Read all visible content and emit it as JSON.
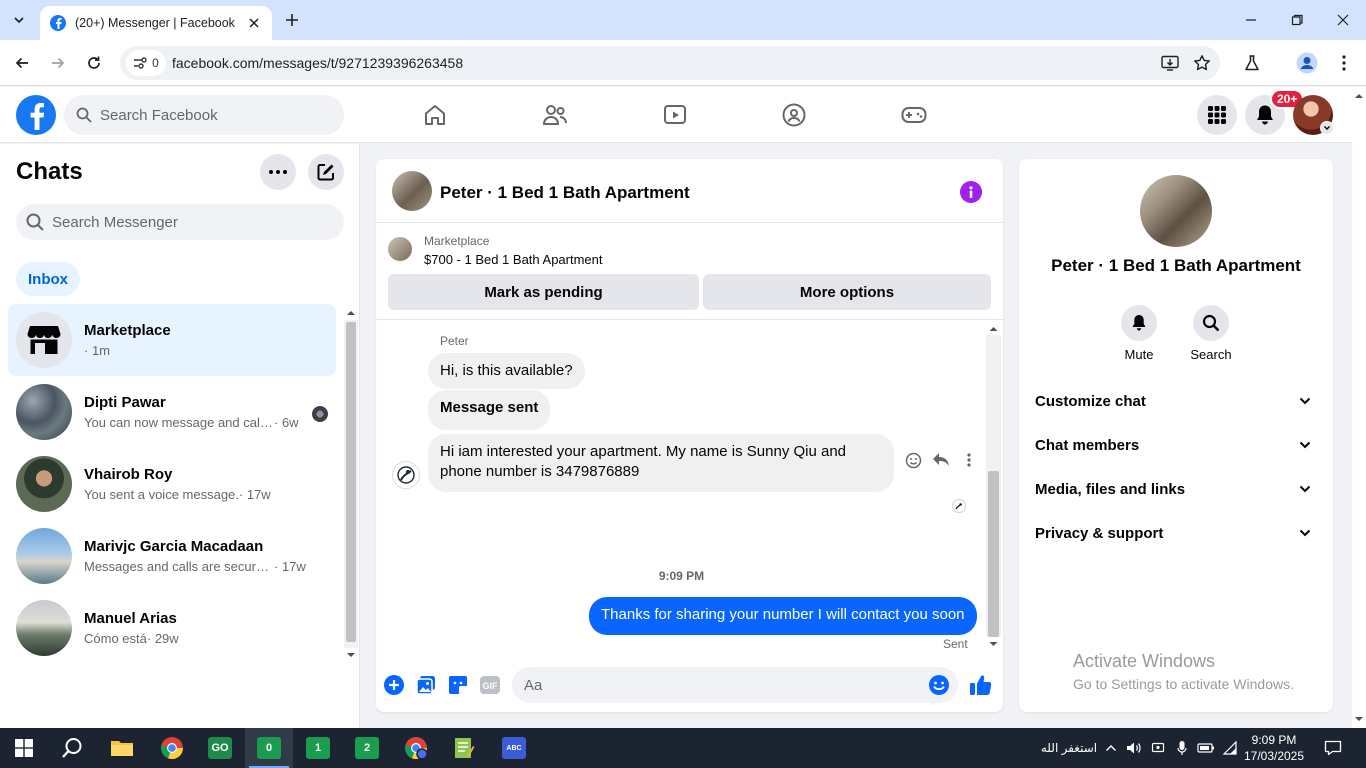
{
  "browser": {
    "tab_title": "(20+) Messenger | Facebook",
    "site_info_count": "0",
    "url": "facebook.com/messages/t/9271239396263458"
  },
  "fb": {
    "search_placeholder": "Search Facebook",
    "notification_badge": "20+"
  },
  "chats": {
    "title": "Chats",
    "search_placeholder": "Search Messenger",
    "filter_inbox": "Inbox",
    "items": [
      {
        "name": "Marketplace",
        "preview": "",
        "time": "· 1m",
        "active": true
      },
      {
        "name": "Dipti Pawar",
        "preview": "You can now message and call ...",
        "time": " · 6w"
      },
      {
        "name": "Vhairob Roy",
        "preview": "You sent a voice message.",
        "time": " · 17w"
      },
      {
        "name": "Marivjc Garcia Macadaan",
        "preview": "Messages and calls are secured w...",
        "time": " · 17w"
      },
      {
        "name": "Manuel Arias",
        "preview": "Cómo está",
        "time": " · 29w"
      }
    ]
  },
  "conversation": {
    "title": "Peter · 1 Bed 1 Bath Apartment",
    "marketplace_label": "Marketplace",
    "listing": "$700 - 1 Bed 1 Bath Apartment",
    "mark_pending": "Mark as pending",
    "more_options": "More options",
    "sender": "Peter",
    "messages": {
      "m1": "Hi, is this available?",
      "m2": "Message sent",
      "m3": "Hi iam interested your apartment. My name is Sunny Qiu and phone number is 3479876889",
      "timestamp": "9:09 PM",
      "m4": "Thanks for sharing your number I will contact you soon",
      "status": "Sent"
    },
    "composer_placeholder": "Aa"
  },
  "details": {
    "name": "Peter · 1 Bed 1 Bath Apartment",
    "mute": "Mute",
    "search": "Search",
    "sections": [
      "Customize chat",
      "Chat members",
      "Media, files and links",
      "Privacy & support"
    ]
  },
  "watermark": {
    "line1": "Activate Windows",
    "line2": "Go to Settings to activate Windows."
  },
  "taskbar": {
    "badges": [
      "0",
      "1",
      "2"
    ],
    "arabic_text": "استغفر الله",
    "time": "9:09 PM",
    "date": "17/03/2025"
  },
  "colors": {
    "fb_blue": "#1877f2",
    "messenger_blue": "#0866ff",
    "info_purple": "#a020f0",
    "notif_red": "#e41e3f"
  }
}
